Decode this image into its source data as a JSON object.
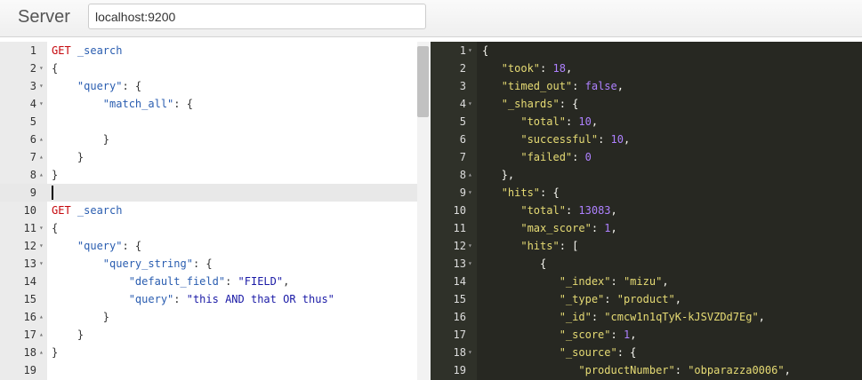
{
  "header": {
    "server_label": "Server",
    "server_url": "localhost:9200"
  },
  "left_editor": {
    "lines": [
      {
        "n": "1",
        "fold": "",
        "tokens": [
          [
            "method",
            "GET "
          ],
          [
            "url",
            "_search"
          ]
        ]
      },
      {
        "n": "2",
        "fold": "▾",
        "tokens": [
          [
            "punc",
            "{"
          ]
        ]
      },
      {
        "n": "3",
        "fold": "▾",
        "tokens": [
          [
            "punc",
            "    "
          ],
          [
            "key",
            "\"query\""
          ],
          [
            "punc",
            ": {"
          ]
        ]
      },
      {
        "n": "4",
        "fold": "▾",
        "tokens": [
          [
            "punc",
            "        "
          ],
          [
            "key",
            "\"match_all\""
          ],
          [
            "punc",
            ": {"
          ]
        ]
      },
      {
        "n": "5",
        "fold": "",
        "tokens": [
          [
            "punc",
            "            "
          ]
        ]
      },
      {
        "n": "6",
        "fold": "▴",
        "tokens": [
          [
            "punc",
            "        }"
          ]
        ]
      },
      {
        "n": "7",
        "fold": "▴",
        "tokens": [
          [
            "punc",
            "    }"
          ]
        ]
      },
      {
        "n": "8",
        "fold": "▴",
        "tokens": [
          [
            "punc",
            "}"
          ]
        ]
      },
      {
        "n": "9",
        "fold": "",
        "tokens": [],
        "active": true
      },
      {
        "n": "10",
        "fold": "",
        "tokens": [
          [
            "method",
            "GET "
          ],
          [
            "url",
            "_search"
          ]
        ]
      },
      {
        "n": "11",
        "fold": "▾",
        "tokens": [
          [
            "punc",
            "{"
          ]
        ]
      },
      {
        "n": "12",
        "fold": "▾",
        "tokens": [
          [
            "punc",
            "    "
          ],
          [
            "key",
            "\"query\""
          ],
          [
            "punc",
            ": {"
          ]
        ]
      },
      {
        "n": "13",
        "fold": "▾",
        "tokens": [
          [
            "punc",
            "        "
          ],
          [
            "key",
            "\"query_string\""
          ],
          [
            "punc",
            ": {"
          ]
        ]
      },
      {
        "n": "14",
        "fold": "",
        "tokens": [
          [
            "punc",
            "            "
          ],
          [
            "key",
            "\"default_field\""
          ],
          [
            "punc",
            ": "
          ],
          [
            "str",
            "\"FIELD\""
          ],
          [
            "punc",
            ","
          ]
        ]
      },
      {
        "n": "15",
        "fold": "",
        "tokens": [
          [
            "punc",
            "            "
          ],
          [
            "key",
            "\"query\""
          ],
          [
            "punc",
            ": "
          ],
          [
            "str",
            "\"this AND that OR thus\""
          ]
        ]
      },
      {
        "n": "16",
        "fold": "▴",
        "tokens": [
          [
            "punc",
            "        }"
          ]
        ]
      },
      {
        "n": "17",
        "fold": "▴",
        "tokens": [
          [
            "punc",
            "    }"
          ]
        ]
      },
      {
        "n": "18",
        "fold": "▴",
        "tokens": [
          [
            "punc",
            "}"
          ]
        ]
      },
      {
        "n": "19",
        "fold": "",
        "tokens": []
      }
    ]
  },
  "right_editor": {
    "lines": [
      {
        "n": "1",
        "fold": "▾",
        "tokens": [
          [
            "punc",
            "{"
          ]
        ]
      },
      {
        "n": "2",
        "fold": "",
        "tokens": [
          [
            "punc",
            "   "
          ],
          [
            "key",
            "\"took\""
          ],
          [
            "punc",
            ": "
          ],
          [
            "num",
            "18"
          ],
          [
            "punc",
            ","
          ]
        ]
      },
      {
        "n": "3",
        "fold": "",
        "tokens": [
          [
            "punc",
            "   "
          ],
          [
            "key",
            "\"timed_out\""
          ],
          [
            "punc",
            ": "
          ],
          [
            "bool",
            "false"
          ],
          [
            "punc",
            ","
          ]
        ]
      },
      {
        "n": "4",
        "fold": "▾",
        "tokens": [
          [
            "punc",
            "   "
          ],
          [
            "key",
            "\"_shards\""
          ],
          [
            "punc",
            ": {"
          ]
        ]
      },
      {
        "n": "5",
        "fold": "",
        "tokens": [
          [
            "punc",
            "      "
          ],
          [
            "key",
            "\"total\""
          ],
          [
            "punc",
            ": "
          ],
          [
            "num",
            "10"
          ],
          [
            "punc",
            ","
          ]
        ]
      },
      {
        "n": "6",
        "fold": "",
        "tokens": [
          [
            "punc",
            "      "
          ],
          [
            "key",
            "\"successful\""
          ],
          [
            "punc",
            ": "
          ],
          [
            "num",
            "10"
          ],
          [
            "punc",
            ","
          ]
        ]
      },
      {
        "n": "7",
        "fold": "",
        "tokens": [
          [
            "punc",
            "      "
          ],
          [
            "key",
            "\"failed\""
          ],
          [
            "punc",
            ": "
          ],
          [
            "num",
            "0"
          ]
        ]
      },
      {
        "n": "8",
        "fold": "▴",
        "tokens": [
          [
            "punc",
            "   },"
          ]
        ]
      },
      {
        "n": "9",
        "fold": "▾",
        "tokens": [
          [
            "punc",
            "   "
          ],
          [
            "key",
            "\"hits\""
          ],
          [
            "punc",
            ": {"
          ]
        ]
      },
      {
        "n": "10",
        "fold": "",
        "tokens": [
          [
            "punc",
            "      "
          ],
          [
            "key",
            "\"total\""
          ],
          [
            "punc",
            ": "
          ],
          [
            "num",
            "13083"
          ],
          [
            "punc",
            ","
          ]
        ]
      },
      {
        "n": "11",
        "fold": "",
        "tokens": [
          [
            "punc",
            "      "
          ],
          [
            "key",
            "\"max_score\""
          ],
          [
            "punc",
            ": "
          ],
          [
            "num",
            "1"
          ],
          [
            "punc",
            ","
          ]
        ]
      },
      {
        "n": "12",
        "fold": "▾",
        "tokens": [
          [
            "punc",
            "      "
          ],
          [
            "key",
            "\"hits\""
          ],
          [
            "punc",
            ": ["
          ]
        ]
      },
      {
        "n": "13",
        "fold": "▾",
        "tokens": [
          [
            "punc",
            "         {"
          ]
        ]
      },
      {
        "n": "14",
        "fold": "",
        "tokens": [
          [
            "punc",
            "            "
          ],
          [
            "key",
            "\"_index\""
          ],
          [
            "punc",
            ": "
          ],
          [
            "str",
            "\"mizu\""
          ],
          [
            "punc",
            ","
          ]
        ]
      },
      {
        "n": "15",
        "fold": "",
        "tokens": [
          [
            "punc",
            "            "
          ],
          [
            "key",
            "\"_type\""
          ],
          [
            "punc",
            ": "
          ],
          [
            "str",
            "\"product\""
          ],
          [
            "punc",
            ","
          ]
        ]
      },
      {
        "n": "16",
        "fold": "",
        "tokens": [
          [
            "punc",
            "            "
          ],
          [
            "key",
            "\"_id\""
          ],
          [
            "punc",
            ": "
          ],
          [
            "str",
            "\"cmcw1n1qTyK-kJSVZDd7Eg\""
          ],
          [
            "punc",
            ","
          ]
        ]
      },
      {
        "n": "17",
        "fold": "",
        "tokens": [
          [
            "punc",
            "            "
          ],
          [
            "key",
            "\"_score\""
          ],
          [
            "punc",
            ": "
          ],
          [
            "num",
            "1"
          ],
          [
            "punc",
            ","
          ]
        ]
      },
      {
        "n": "18",
        "fold": "▾",
        "tokens": [
          [
            "punc",
            "            "
          ],
          [
            "key",
            "\"_source\""
          ],
          [
            "punc",
            ": {"
          ]
        ]
      },
      {
        "n": "19",
        "fold": "",
        "tokens": [
          [
            "punc",
            "               "
          ],
          [
            "key",
            "\"productNumber\""
          ],
          [
            "punc",
            ": "
          ],
          [
            "str",
            "\"obparazza0006\""
          ],
          [
            "punc",
            ","
          ]
        ]
      }
    ]
  }
}
